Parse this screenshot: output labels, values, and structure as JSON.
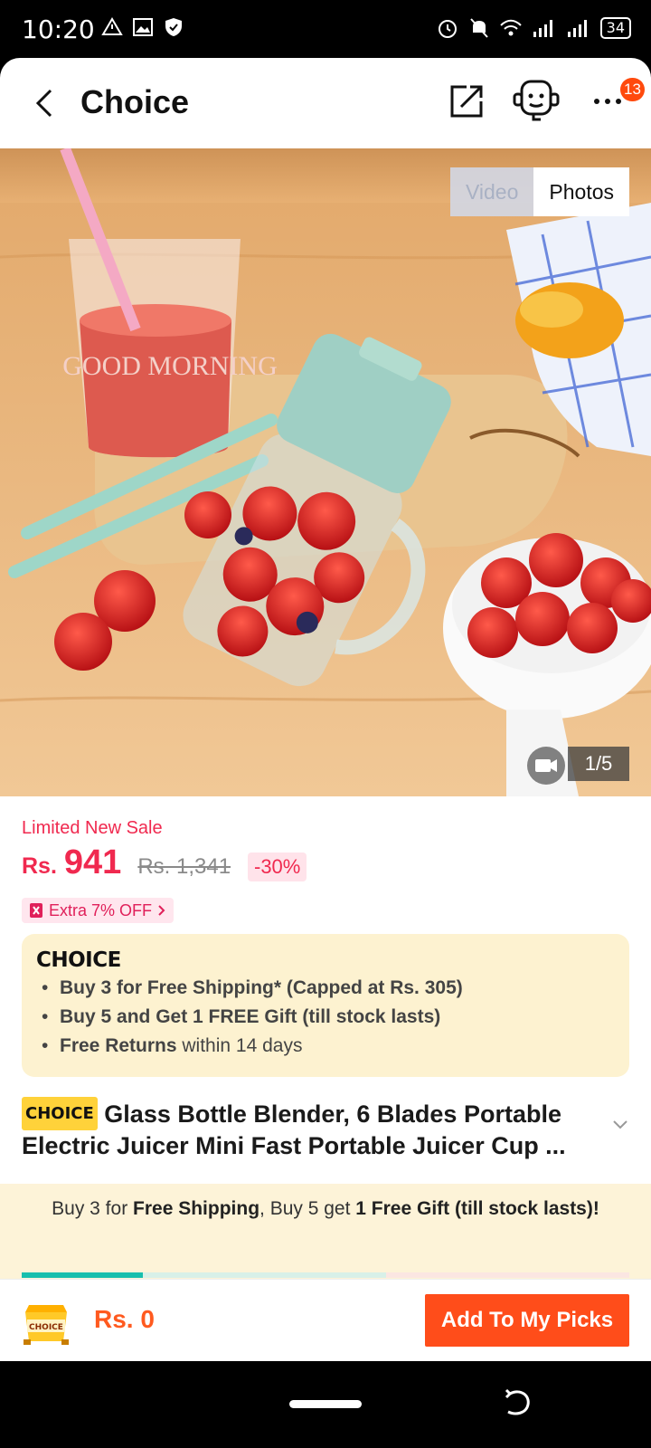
{
  "status_bar": {
    "time": "10:20",
    "battery": "34"
  },
  "header": {
    "title": "Choice",
    "more_badge": "13"
  },
  "gallery": {
    "tabs": [
      "Video",
      "Photos"
    ],
    "selected_tab": "Photos",
    "counter": "1/5",
    "image_text": "GOOD MORNING"
  },
  "pricing": {
    "sale_label": "Limited New Sale",
    "currency": "Rs.",
    "price": "941",
    "original_price": "Rs. 1,341",
    "discount": "-30%",
    "coupon": "Extra 7% OFF"
  },
  "choice_box": {
    "logo": "CHOICE",
    "perk1": "Buy 3 for  Free Shipping* (Capped at Rs. 305)",
    "perk2": "Buy 5 and Get 1 FREE Gift (till stock lasts)",
    "perk3_bold": "Free Returns",
    "perk3_rest": " within 14 days"
  },
  "product": {
    "tag": "CHOICE",
    "title_line1": "Glass Bottle Blender, 6 Blades Portable",
    "title_line2": "Electric Juicer Mini Fast Portable Juicer Cup ..."
  },
  "promo": {
    "p1": "Buy 3 for ",
    "p2": "Free Shipping",
    "p3": ", Buy 5 get ",
    "p4": "1 Free Gift (till stock lasts)!",
    "progress_fraction": 0.2
  },
  "bottom_bar": {
    "cart_label": "CHOICE",
    "total": "Rs. 0",
    "cta": "Add To My Picks"
  },
  "colors": {
    "accent": "#f0294f",
    "cta": "#ff4d1a",
    "progress": "#17bfae",
    "choice_bg": "#fdf2d0"
  }
}
